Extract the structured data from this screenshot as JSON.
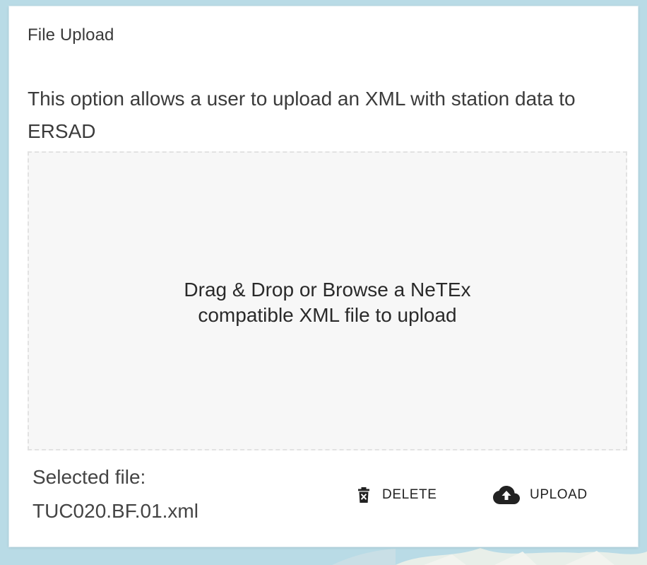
{
  "panel": {
    "title": "File Upload",
    "description": "This option allows a user to upload an XML with station data to ERSAD"
  },
  "drop_zone": {
    "text": "Drag & Drop or Browse a NeTEx compatible XML file to upload"
  },
  "selected_file": {
    "label": "Selected file:",
    "name": "TUC020.BF.01.xml"
  },
  "actions": {
    "delete_label": "DELETE",
    "delete_icon": "trash-x-icon",
    "upload_label": "UPLOAD",
    "upload_icon": "cloud-upload-icon"
  },
  "colors": {
    "background": "#b9dbe6",
    "panel": "#ffffff",
    "drop_zone": "#f7f7f7",
    "text": "#333333"
  }
}
